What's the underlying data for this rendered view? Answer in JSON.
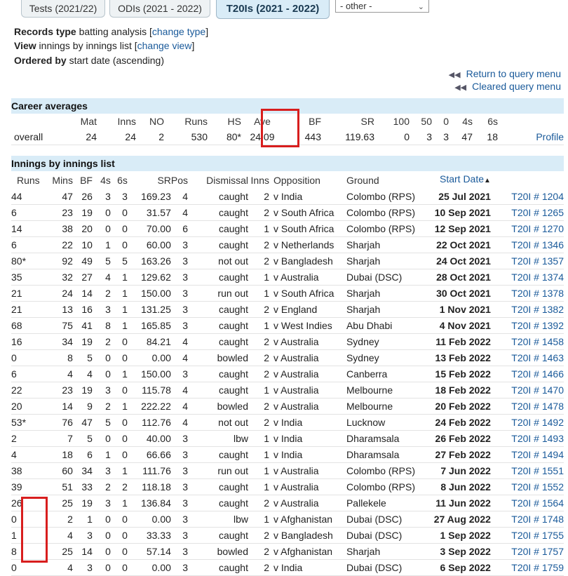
{
  "tabs": [
    {
      "label": "Tests (2021/22)",
      "active": false
    },
    {
      "label": "ODIs (2021 - 2022)",
      "active": false
    },
    {
      "label": "T20Is (2021 - 2022)",
      "active": true
    }
  ],
  "select": {
    "value": "- other -"
  },
  "info": {
    "records_type_label": "Records type",
    "records_type_value": "batting analysis [",
    "records_type_link": "change type",
    "view_label": "View",
    "view_value": "innings by innings list [",
    "view_link": "change view",
    "ordered_label": "Ordered by",
    "ordered_value": "start date (ascending)",
    "close_bracket": "]"
  },
  "links": {
    "return_query": "Return to query menu",
    "cleared_query": "Cleared query menu"
  },
  "career": {
    "title": "Career averages",
    "headers": [
      "",
      "Mat",
      "Inns",
      "NO",
      "Runs",
      "HS",
      "Ave",
      "BF",
      "SR",
      "100",
      "50",
      "0",
      "4s",
      "6s",
      ""
    ],
    "row": [
      "overall",
      "24",
      "24",
      "2",
      "530",
      "80*",
      "24.09",
      "443",
      "119.63",
      "0",
      "3",
      "3",
      "47",
      "18",
      "Profile"
    ]
  },
  "innings": {
    "title": "Innings by innings list",
    "headers": [
      "Runs",
      "Mins",
      "BF",
      "4s",
      "6s",
      "SR",
      "Pos",
      "Dismissal",
      "Inns",
      "Opposition",
      "Ground",
      "Start Date",
      ""
    ],
    "sort_icon": "sort-up-icon",
    "rows": [
      [
        "44",
        "47",
        "26",
        "3",
        "3",
        "169.23",
        "4",
        "caught",
        "2",
        "v India",
        "Colombo (RPS)",
        "25 Jul 2021",
        "T20I # 1204"
      ],
      [
        "6",
        "23",
        "19",
        "0",
        "0",
        "31.57",
        "4",
        "caught",
        "2",
        "v South Africa",
        "Colombo (RPS)",
        "10 Sep 2021",
        "T20I # 1265"
      ],
      [
        "14",
        "38",
        "20",
        "0",
        "0",
        "70.00",
        "6",
        "caught",
        "1",
        "v South Africa",
        "Colombo (RPS)",
        "12 Sep 2021",
        "T20I # 1270"
      ],
      [
        "6",
        "22",
        "10",
        "1",
        "0",
        "60.00",
        "3",
        "caught",
        "2",
        "v Netherlands",
        "Sharjah",
        "22 Oct 2021",
        "T20I # 1346"
      ],
      [
        "80*",
        "92",
        "49",
        "5",
        "5",
        "163.26",
        "3",
        "not out",
        "2",
        "v Bangladesh",
        "Sharjah",
        "24 Oct 2021",
        "T20I # 1357"
      ],
      [
        "35",
        "32",
        "27",
        "4",
        "1",
        "129.62",
        "3",
        "caught",
        "1",
        "v Australia",
        "Dubai (DSC)",
        "28 Oct 2021",
        "T20I # 1374"
      ],
      [
        "21",
        "24",
        "14",
        "2",
        "1",
        "150.00",
        "3",
        "run out",
        "1",
        "v South Africa",
        "Sharjah",
        "30 Oct 2021",
        "T20I # 1378"
      ],
      [
        "21",
        "13",
        "16",
        "3",
        "1",
        "131.25",
        "3",
        "caught",
        "2",
        "v England",
        "Sharjah",
        "1 Nov 2021",
        "T20I # 1382"
      ],
      [
        "68",
        "75",
        "41",
        "8",
        "1",
        "165.85",
        "3",
        "caught",
        "1",
        "v West Indies",
        "Abu Dhabi",
        "4 Nov 2021",
        "T20I # 1392"
      ],
      [
        "16",
        "34",
        "19",
        "2",
        "0",
        "84.21",
        "4",
        "caught",
        "2",
        "v Australia",
        "Sydney",
        "11 Feb 2022",
        "T20I # 1458"
      ],
      [
        "0",
        "8",
        "5",
        "0",
        "0",
        "0.00",
        "4",
        "bowled",
        "2",
        "v Australia",
        "Sydney",
        "13 Feb 2022",
        "T20I # 1463"
      ],
      [
        "6",
        "4",
        "4",
        "0",
        "1",
        "150.00",
        "3",
        "caught",
        "2",
        "v Australia",
        "Canberra",
        "15 Feb 2022",
        "T20I # 1466"
      ],
      [
        "22",
        "23",
        "19",
        "3",
        "0",
        "115.78",
        "4",
        "caught",
        "1",
        "v Australia",
        "Melbourne",
        "18 Feb 2022",
        "T20I # 1470"
      ],
      [
        "20",
        "14",
        "9",
        "2",
        "1",
        "222.22",
        "4",
        "bowled",
        "2",
        "v Australia",
        "Melbourne",
        "20 Feb 2022",
        "T20I # 1478"
      ],
      [
        "53*",
        "76",
        "47",
        "5",
        "0",
        "112.76",
        "4",
        "not out",
        "2",
        "v India",
        "Lucknow",
        "24 Feb 2022",
        "T20I # 1492"
      ],
      [
        "2",
        "7",
        "5",
        "0",
        "0",
        "40.00",
        "3",
        "lbw",
        "1",
        "v India",
        "Dharamsala",
        "26 Feb 2022",
        "T20I # 1493"
      ],
      [
        "4",
        "18",
        "6",
        "1",
        "0",
        "66.66",
        "3",
        "caught",
        "1",
        "v India",
        "Dharamsala",
        "27 Feb 2022",
        "T20I # 1494"
      ],
      [
        "38",
        "60",
        "34",
        "3",
        "1",
        "111.76",
        "3",
        "run out",
        "1",
        "v Australia",
        "Colombo (RPS)",
        "7 Jun 2022",
        "T20I # 1551"
      ],
      [
        "39",
        "51",
        "33",
        "2",
        "2",
        "118.18",
        "3",
        "caught",
        "1",
        "v Australia",
        "Colombo (RPS)",
        "8 Jun 2022",
        "T20I # 1552"
      ],
      [
        "26",
        "25",
        "19",
        "3",
        "1",
        "136.84",
        "3",
        "caught",
        "2",
        "v Australia",
        "Pallekele",
        "11 Jun 2022",
        "T20I # 1564"
      ],
      [
        "0",
        "2",
        "1",
        "0",
        "0",
        "0.00",
        "3",
        "lbw",
        "1",
        "v Afghanistan",
        "Dubai (DSC)",
        "27 Aug 2022",
        "T20I # 1748"
      ],
      [
        "1",
        "4",
        "3",
        "0",
        "0",
        "33.33",
        "3",
        "caught",
        "2",
        "v Bangladesh",
        "Dubai (DSC)",
        "1 Sep 2022",
        "T20I # 1755"
      ],
      [
        "8",
        "25",
        "14",
        "0",
        "0",
        "57.14",
        "3",
        "bowled",
        "2",
        "v Afghanistan",
        "Sharjah",
        "3 Sep 2022",
        "T20I # 1757"
      ],
      [
        "0",
        "4",
        "3",
        "0",
        "0",
        "0.00",
        "3",
        "caught",
        "2",
        "v India",
        "Dubai (DSC)",
        "6 Sep 2022",
        "T20I # 1759"
      ]
    ]
  },
  "highlight_color": "#d81e1e"
}
